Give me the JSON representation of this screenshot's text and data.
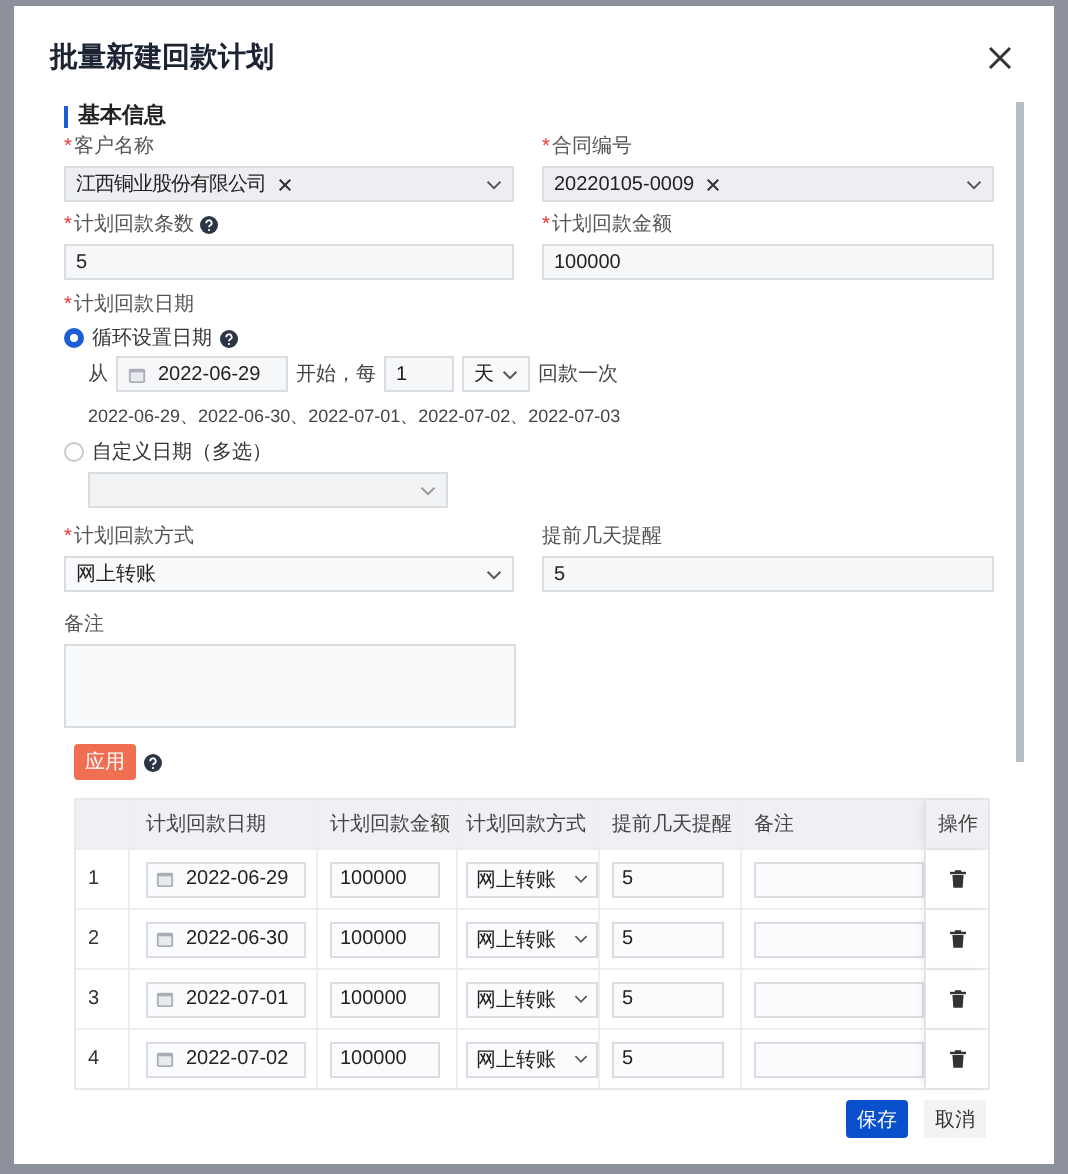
{
  "dialog": {
    "title": "批量新建回款计划"
  },
  "section": {
    "title": "基本信息"
  },
  "customer": {
    "mark": "*",
    "label": "客户名称",
    "tag": "江西铜业股份有限公司"
  },
  "contract": {
    "mark": "*",
    "label": "合同编号",
    "tag": "20220105-0009"
  },
  "count": {
    "mark": "*",
    "label": "计划回款条数",
    "value": "5"
  },
  "amount": {
    "mark": "*",
    "label": "计划回款金额",
    "value": "100000"
  },
  "date_plan": {
    "mark": "*",
    "label": "计划回款日期",
    "options": [
      {
        "label": "循环设置日期",
        "selected": true
      },
      {
        "label": "自定义日期（多选）",
        "selected": false
      }
    ],
    "cycle": {
      "from": "从",
      "start": "2022-06-29",
      "middle": "开始，每",
      "every": "1",
      "unit": "天",
      "tail": "回款一次"
    },
    "preview": "2022-06-29、2022-06-30、2022-07-01、2022-07-02、2022-07-03"
  },
  "method": {
    "mark": "*",
    "label": "计划回款方式",
    "value": "网上转账"
  },
  "remind": {
    "label": "提前几天提醒",
    "value": "5"
  },
  "note": {
    "label": "备注"
  },
  "apply_button": "应用",
  "table": {
    "columns": [
      "计划回款日期",
      "计划回款金额",
      "计划回款方式",
      "提前几天提醒",
      "备注",
      "操作"
    ],
    "rows": [
      {
        "index": "1",
        "date": "2022-06-29",
        "amount": "100000",
        "method": "网上转账",
        "remind": "5"
      },
      {
        "index": "2",
        "date": "2022-06-30",
        "amount": "100000",
        "method": "网上转账",
        "remind": "5"
      },
      {
        "index": "3",
        "date": "2022-07-01",
        "amount": "100000",
        "method": "网上转账",
        "remind": "5"
      },
      {
        "index": "4",
        "date": "2022-07-02",
        "amount": "100000",
        "method": "网上转账",
        "remind": "5"
      }
    ]
  },
  "buttons": {
    "save": "保存",
    "cancel": "取消"
  }
}
